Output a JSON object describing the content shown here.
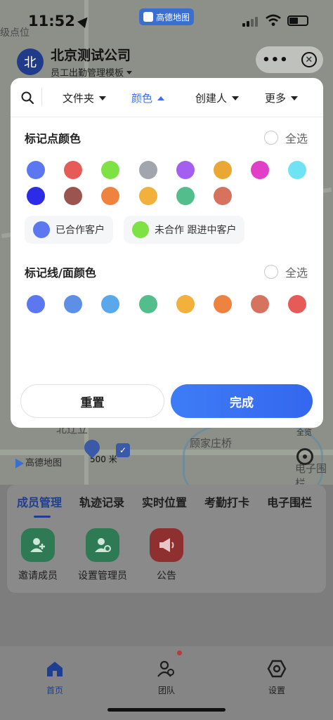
{
  "status_bar": {
    "time": "11:52",
    "mini_app_name": "高德地图"
  },
  "header": {
    "avatar_text": "北",
    "company": "北京测试公司",
    "template": "员工出勤管理模板",
    "more_label": "•••"
  },
  "map": {
    "labels": [
      "级点位",
      "全览",
      "顾家庄桥",
      "电子围栏",
      "北辽立"
    ],
    "brand": "高德地图",
    "scale": "500 米"
  },
  "filter": {
    "tabs": [
      {
        "label": "文件夹",
        "active": false
      },
      {
        "label": "颜色",
        "active": true
      },
      {
        "label": "创建人",
        "active": false
      },
      {
        "label": "更多",
        "active": false
      }
    ],
    "marker_section": {
      "title": "标记点颜色",
      "select_all": "全选",
      "colors": [
        "#5b78f0",
        "#e65a57",
        "#7ee244",
        "#a1a5ad",
        "#a45ef0",
        "#eaa733",
        "#e23fc9",
        "#6fe2f3",
        "#2b2be8",
        "#9c5451",
        "#ee8340",
        "#f2b13d",
        "#52be8b",
        "#d6735f"
      ],
      "legend": [
        {
          "color": "#5b78f0",
          "label": "已合作客户"
        },
        {
          "color": "#7ee244",
          "label": "未合作 跟进中客户"
        }
      ]
    },
    "line_section": {
      "title": "标记线/面颜色",
      "select_all": "全选",
      "colors": [
        "#5b78f0",
        "#5e8fe6",
        "#5aa8ec",
        "#52be8b",
        "#f2b13d",
        "#ee8340",
        "#d6735f",
        "#e65a57"
      ]
    },
    "buttons": {
      "reset": "重置",
      "done": "完成"
    }
  },
  "bottom_panel": {
    "tabs": [
      "成员管理",
      "轨迹记录",
      "实时位置",
      "考勤打卡",
      "电子围栏"
    ],
    "active_tab": 0,
    "apps": [
      {
        "label": "邀请成员",
        "icon": "add-user-icon",
        "color": "#2d7a55"
      },
      {
        "label": "设置管理员",
        "icon": "admin-settings-icon",
        "color": "#2d7a55"
      },
      {
        "label": "公告",
        "icon": "megaphone-icon",
        "color": "#8e3030"
      }
    ]
  },
  "tabbar": {
    "items": [
      {
        "label": "首页",
        "icon": "home-icon",
        "active": true
      },
      {
        "label": "团队",
        "icon": "team-icon",
        "active": false,
        "badge": true
      },
      {
        "label": "设置",
        "icon": "settings-icon",
        "active": false
      }
    ]
  }
}
